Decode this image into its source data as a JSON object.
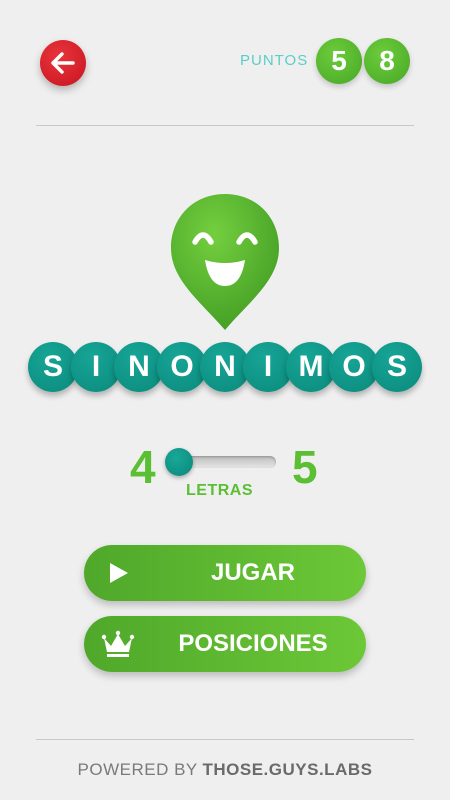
{
  "header": {
    "back_icon": "arrow-left-icon",
    "points_label": "PUNTOS",
    "points_digits": [
      "5",
      "8"
    ]
  },
  "logo": {
    "icon": "smiley-pin-icon",
    "title_letters": [
      "S",
      "I",
      "N",
      "O",
      "N",
      "I",
      "M",
      "O",
      "S"
    ]
  },
  "word_length": {
    "min": "4",
    "max": "5",
    "selected": 4,
    "label": "LETRAS"
  },
  "buttons": {
    "play_label": "JUGAR",
    "play_icon": "play-icon",
    "rankings_label": "POSICIONES",
    "rankings_icon": "crown-icon"
  },
  "footer": {
    "powered_by": "POWERED BY",
    "brand": "THOSE.GUYS.LABS"
  },
  "colors": {
    "background": "#efefef",
    "accent_green": "#5bbf34",
    "teal": "#0f9a8b",
    "back_red": "#d91f2a",
    "points_label": "#5ccdc9"
  }
}
